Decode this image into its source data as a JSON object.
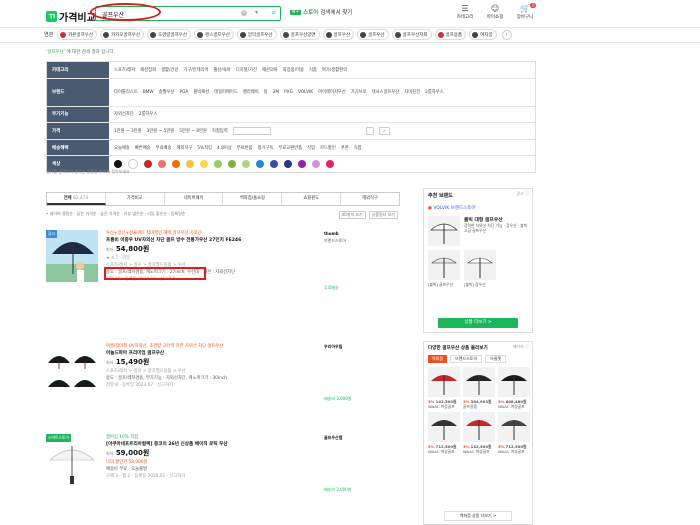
{
  "header": {
    "logo_mark": "ㄲ",
    "logo_text": "가격비교",
    "search_query": "골프우산",
    "campaign_tag": "N+",
    "campaign_green": "스토어",
    "campaign_text": "검색에서 찾기",
    "icons": [
      {
        "name": "category",
        "label": "카테고리"
      },
      {
        "name": "my",
        "label": "마이쇼핑"
      },
      {
        "name": "cart",
        "label": "장바구니",
        "badge": "0"
      }
    ]
  },
  "related": {
    "label": "연관",
    "chips": [
      "카본골프우산",
      "카카오골프우산",
      "초경량골프우산",
      "랜스골프우산",
      "암막골프우산",
      "골프우산양면",
      "골프우산",
      "골프우산",
      "골프우산자외",
      "골프용품",
      "여자골"
    ]
  },
  "notice": {
    "query": "'골프우산'",
    "rest": " 에 대한 검색 결과 입니다."
  },
  "filters": [
    {
      "head": "카테고리",
      "items": [
        "스포츠/레저",
        "패션잡화",
        "생활/건강",
        "가구/인테리어",
        "출산/육아",
        "디지털/가전",
        "패션의류",
        "화장품/미용",
        "식품",
        "여가/생활편의"
      ]
    },
    {
      "head": "브랜드",
      "items": [
        "타이틀리스트",
        "BMW",
        "송월우산",
        "PGA",
        "볼빅패션",
        "테일러메이드",
        "캘러웨이",
        "핑",
        "3M",
        "PXG",
        "VOLVIK",
        "마이레이저우산",
        "가거브로",
        "텍사스골프우산",
        "자미진전",
        "2룸하우스"
      ]
    },
    {
      "head": "부가기능",
      "items": [
        "자외선차단",
        "2룸하우스"
      ]
    },
    {
      "head": "가격",
      "items": [
        "1만원 ~ 3만원",
        "3만원 ~ 5만원",
        "5만원 ~ 8만원",
        "직접입력"
      ]
    },
    {
      "head": "배송혜택",
      "items": [
        "오늘배송",
        "빠른배송",
        "무료배송",
        "해외직구",
        "5%적립",
        "4.8이상",
        "무료반품",
        "정기구독",
        "무료교환반품",
        "작업",
        "카드할인",
        "쿠폰",
        "직접"
      ]
    },
    {
      "head": "색상",
      "swatches": [
        "#111111",
        "#ffffff",
        "#c62828",
        "#e57373",
        "#ef6c00",
        "#f6c343",
        "#ffd54f",
        "#9ccc65",
        "#7cb342",
        "#aed581",
        "#1e88e5",
        "#3949ab",
        "#283593",
        "#8e24aa",
        "#ce93d8",
        "#e91e63"
      ]
    }
  ],
  "filter_note": "필터를 선택하여 원하는 상품을 빠르게 찾아보세요.",
  "tabs": [
    {
      "label": "전체",
      "count": "82,474",
      "active": true
    },
    {
      "label": "가격비교",
      "count": "",
      "active": false
    },
    {
      "label": "네이버페이",
      "count": "",
      "active": false
    },
    {
      "label": "백화점/홈쇼핑",
      "count": "",
      "active": false
    },
    {
      "label": "쇼핑윈도",
      "count": "",
      "active": false
    },
    {
      "label": "해외직구",
      "count": "",
      "active": false
    }
  ],
  "sort": {
    "left": "• 네이버 랭킹순 · 낮은 가격순 · 높은 가격순 · 리뷰 많은순 · 리뷰 좋은순 · 등록일순",
    "right1": "40개씩 보기",
    "right2": "상품필터 보기"
  },
  "products": [
    {
      "badge": "광고",
      "ad": "우산+양산+선물세트 최대할인 혜택 골프우산 자외선",
      "title": "프롱비 이중우 UV자외선 차단 골프 방수 전통가우산 27인치 FE246",
      "price": "54,800원",
      "price_note": "최저",
      "cat": "스포츠/레저 > 골프 > 골프필드용품 > 우산",
      "spec": "용도 : 골프/레저겸용, 캐노피크기 : 27inch, 우산대 : 카본 : 자외선차단",
      "extra": "리뷰 15 · 등록일 2024.03 · 신고하기",
      "seller": "thumb",
      "seller_tag": "브랜드스토어",
      "ship": "무료배송"
    },
    {
      "badge": "",
      "ad": "여름/장마철 UV자외선, 초경량 고탄력 카본 자외선 차단 골프우산",
      "title": "아놀드파마 프리미엄 골프우산",
      "price": "15,490원",
      "price_note": "최저",
      "cat": "스포츠/레저 > 골프 > 골프필드용품 > 우산",
      "spec": "용도 : 골프/레저겸용, 부가기능 : 자외선차단, 캐노피크기 : 30inch",
      "extra": "리뷰 8 · 등록일 2023.07 · 신고하기",
      "seller": "우리아우팀",
      "seller_tag": "",
      "ship": "배송비 3,000원"
    },
    {
      "badge": "스마트스토어",
      "ad": "멤버십 10% 적립",
      "title": "[아쿠아네프트리아컬렉] 몽코의 26년 신상품 베이직 로틱 우산",
      "price": "59,000원",
      "price_note": "최저",
      "sale": "나의 할인가 58,000원",
      "cat": "스포츠/레저 > 골프 > 골프필드용품 > 우산",
      "spec": "배송비 무료 · 오늘출발",
      "extra": "구매 3 · 찜 2 · 등록일 2020.01 · 신고하기",
      "seller": "골프우산랩",
      "seller_tag": "",
      "ship": "배송비 3,000원"
    }
  ],
  "aside": {
    "title": "추천 브랜드",
    "more": "광고 ⓘ",
    "brand": "VOLVIK 브랜드스토어",
    "brand_headline": "볼빅 대형 골프우산",
    "brand_desc": "강력한 자외선 차단 기능 · 장우산 · 볼빅 고급 골프우산",
    "product_a": "[볼빅] 골프우산",
    "product_b": "[볼빅] 장우산",
    "cta": "상품 더보기 >",
    "section2": "다양한 골프우산 상품 둘러보기",
    "section2_more": "페이지 ⓘ",
    "tabs": [
      "백화점",
      "브랜드스토어",
      "아울렛"
    ],
    "grid": [
      {
        "pct": "3%",
        "price": "142,500원",
        "seller": "WAAC 여성골프"
      },
      {
        "pct": "3%",
        "price": "384,993원",
        "seller": "골프용품"
      },
      {
        "pct": "3%",
        "price": "608,480원",
        "seller": "WAAC 여성골프"
      },
      {
        "pct": "5%",
        "price": "712,500원",
        "seller": "WAAC 여성골프"
      },
      {
        "pct": "3%",
        "price": "142,500원",
        "seller": "WAAC 여성골프"
      },
      {
        "pct": "5%",
        "price": "712,500원",
        "seller": "WAAC 여성골프"
      }
    ],
    "more2": "백화점 상품 더보기 >"
  }
}
